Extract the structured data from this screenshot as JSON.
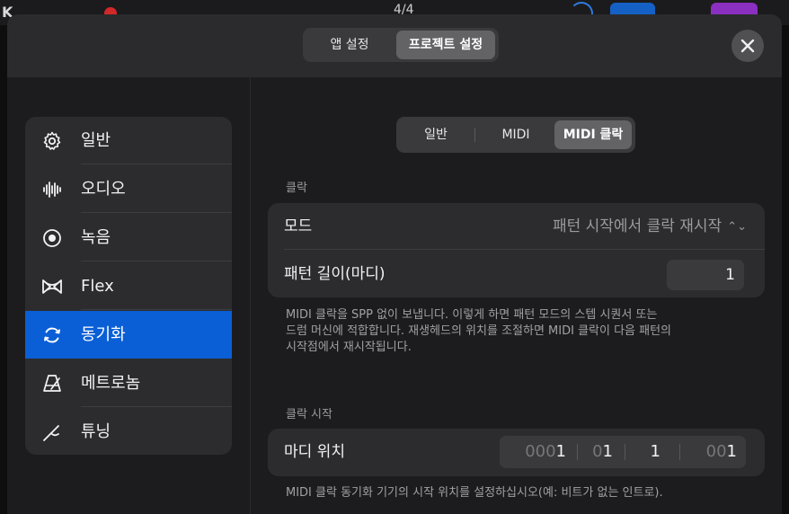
{
  "background_toolbar": {
    "signature": "4/4",
    "logo_letter": "K",
    "colors": {
      "record": "#d2282a",
      "accent_blue": "#1560c4",
      "accent_purple": "#8a2fbf"
    }
  },
  "header": {
    "segments": [
      {
        "label": "앱 설정",
        "selected": false
      },
      {
        "label": "프로젝트 설정",
        "selected": true
      }
    ],
    "close_icon": "close-icon"
  },
  "sidebar": {
    "items": [
      {
        "label": "일반",
        "icon": "gear-icon",
        "active": false
      },
      {
        "label": "오디오",
        "icon": "waveform-icon",
        "active": false
      },
      {
        "label": "녹음",
        "icon": "record-icon",
        "active": false
      },
      {
        "label": "Flex",
        "icon": "flex-icon",
        "active": false
      },
      {
        "label": "동기화",
        "icon": "sync-icon",
        "active": true
      },
      {
        "label": "메트로놈",
        "icon": "metronome-icon",
        "active": false
      },
      {
        "label": "튜닝",
        "icon": "tuning-fork-icon",
        "active": false
      }
    ],
    "active_color": "#0a5fd6"
  },
  "tabs": [
    {
      "label": "일반",
      "selected": false
    },
    {
      "label": "MIDI",
      "selected": false
    },
    {
      "label": "MIDI 클락",
      "selected": true
    }
  ],
  "click_section": {
    "heading": "클락",
    "mode_label": "모드",
    "mode_value": "패턴 시작에서 클락 재시작",
    "pattern_length_label": "패턴 길이(마디)",
    "pattern_length_value": "1",
    "description_line1": "MIDI 클락을 SPP 없이 보냅니다. 이렇게 하면 패턴 모드의 스텝 시퀀서 또는",
    "description_line2": "드럼 머신에 적합합니다. 재생헤드의 위치를 조절하면 MIDI 클락이 다음 패턴의",
    "description_line3": "시작점에서 재시작됩니다."
  },
  "clock_start_section": {
    "heading": "클락 시작",
    "bar_position_label": "마디 위치",
    "position": [
      {
        "dim": "000",
        "bright": "1"
      },
      {
        "dim": "0",
        "bright": "1"
      },
      {
        "dim": "",
        "bright": "1"
      },
      {
        "dim": "00",
        "bright": "1"
      }
    ],
    "description": "MIDI 클락 동기화 기기의 시작 위치를 설정하십시오(예: 비트가 없는 인트로)."
  }
}
